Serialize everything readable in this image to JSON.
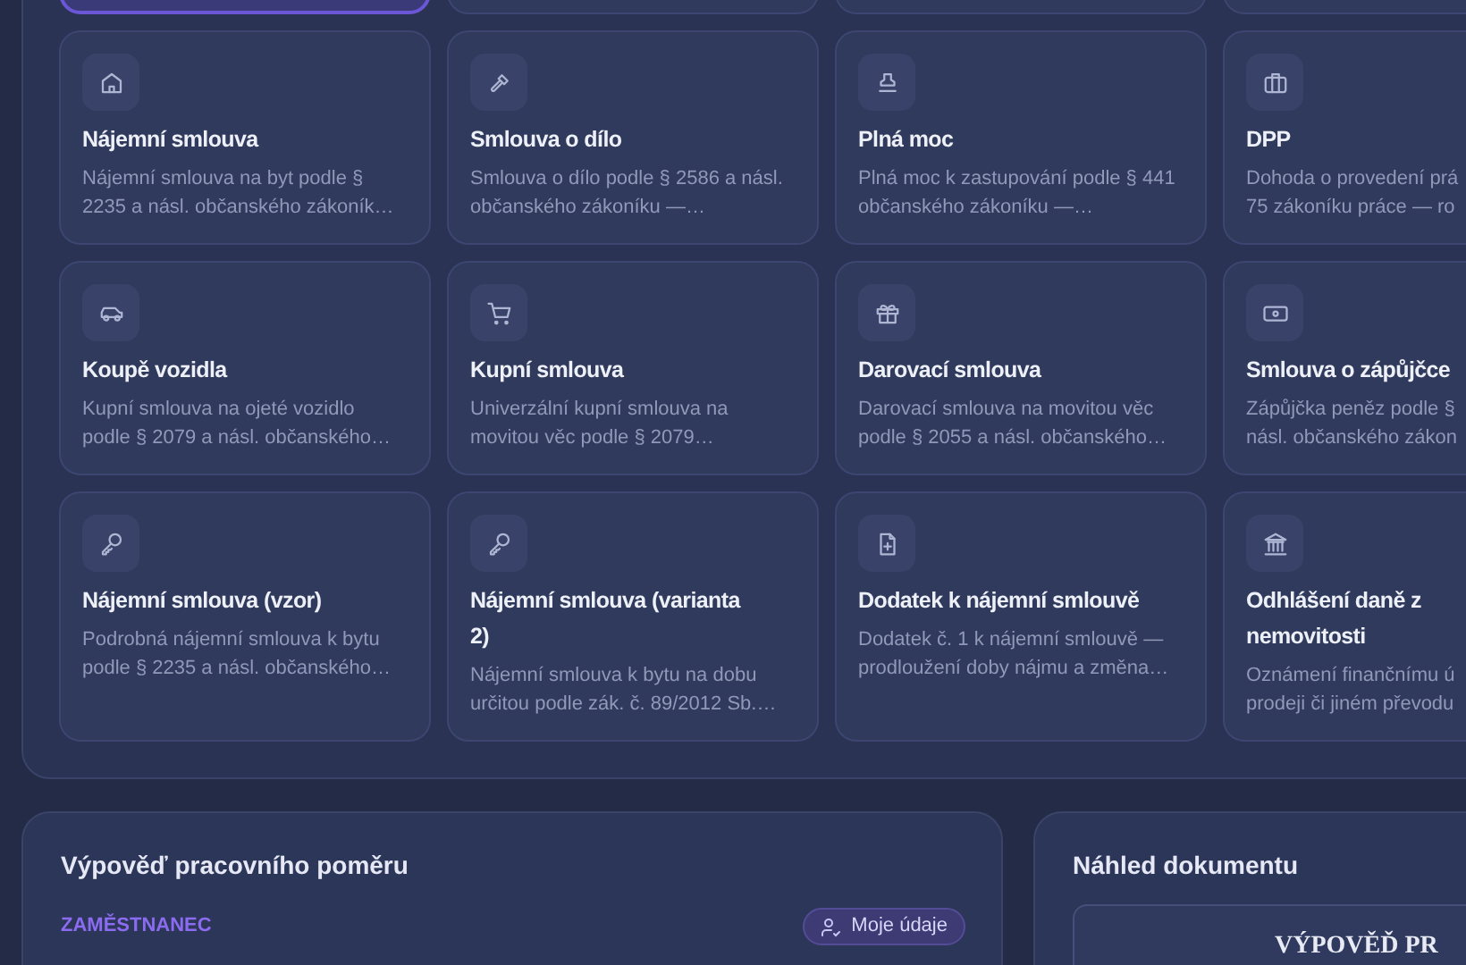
{
  "top_cards": [
    {
      "selected": true
    },
    {
      "selected": false
    },
    {
      "selected": false
    },
    {
      "selected": false
    }
  ],
  "templates": [
    {
      "title": "Nájemní smlouva",
      "description": "Nájemní smlouva na byt podle § 2235 a násl. občanského zákoník…"
    },
    {
      "title": "Smlouva o dílo",
      "description": "Smlouva o dílo podle § 2586 a násl. občanského zákoníku —…"
    },
    {
      "title": "Plná moc",
      "description": "Plná moc k zastupování podle § 441 občanského zákoníku —…"
    },
    {
      "title": "DPP",
      "description": "Dohoda o provedení prá\n75 zákoníku práce — ro"
    },
    {
      "title": "Koupě vozidla",
      "description": "Kupní smlouva na ojeté vozidlo podle § 2079 a násl. občanského…"
    },
    {
      "title": "Kupní smlouva",
      "description": "Univerzální kupní smlouva na movitou věc podle § 2079…"
    },
    {
      "title": "Darovací smlouva",
      "description": "Darovací smlouva na movitou věc podle § 2055 a násl. občanského…"
    },
    {
      "title": "Smlouva o zápůjčce",
      "description": "Zápůjčka peněz podle §\nnásl. občanského zákon"
    },
    {
      "title": "Nájemní smlouva (vzor)",
      "description": "Podrobná nájemní smlouva k bytu podle § 2235 a násl. občanského…"
    },
    {
      "title": "Nájemní smlouva (varianta 2)",
      "description": "Nájemní smlouva k bytu na dobu určitou podle zák. č. 89/2012 Sb.…"
    },
    {
      "title": "Dodatek k nájemní smlouvě",
      "description": "Dodatek č. 1 k nájemní smlouvě — prodloužení doby nájmu a změna…"
    },
    {
      "title": "Odhlášení daně z nemovitosti",
      "description": "Oznámení finančnímu ú\nprodeji či jiném převodu"
    }
  ],
  "form_panel": {
    "title": "Výpověď pracovního poměru",
    "section_label": "ZAMĚSTNANEC",
    "my_data_button": "Moje údaje"
  },
  "preview_panel": {
    "title": "Náhled dokumentu",
    "document_heading": "VÝPOVĚĎ PR"
  }
}
